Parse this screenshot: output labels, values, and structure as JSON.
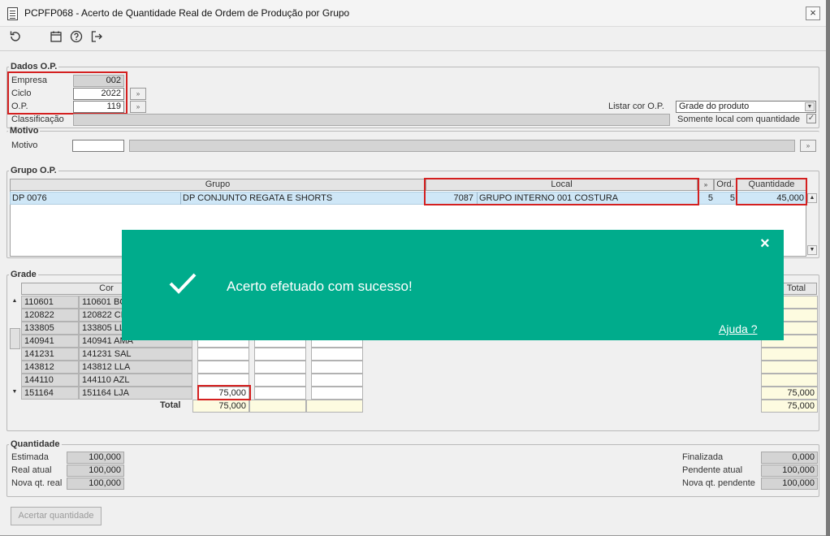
{
  "window": {
    "title": "PCPFP068 - Acerto de Quantidade Real de Ordem de Produção por Grupo",
    "close_label": "×"
  },
  "toolbar": {
    "icons": [
      "refresh-icon",
      "calendar-icon",
      "help-icon",
      "exit-icon"
    ]
  },
  "dados_op": {
    "legend": "Dados O.P.",
    "empresa_label": "Empresa",
    "empresa_value": "002",
    "ciclo_label": "Ciclo",
    "ciclo_value": "2022",
    "op_label": "O.P.",
    "op_value": "119",
    "classificacao_label": "Classificação",
    "classificacao_value": "",
    "listar_cor_label": "Listar cor O.P.",
    "listar_cor_value": "Grade do produto",
    "somente_local_label": "Somente local com quantidade",
    "somente_local_checked": true
  },
  "motivo": {
    "legend": "Motivo",
    "label": "Motivo",
    "code_value": "",
    "description_value": ""
  },
  "grupo_op": {
    "legend": "Grupo O.P.",
    "headers": {
      "grupo": "Grupo",
      "local": "Local",
      "ord": "Ord.",
      "quantidade": "Quantidade"
    },
    "rows": [
      {
        "grupo_code": "DP 0076",
        "grupo_name": "DP CONJUNTO REGATA E SHORTS",
        "local_code": "7087",
        "local_name": "GRUPO INTERNO 001 COSTURA",
        "col_a": "5",
        "ord": "5",
        "quantidade": "45,000"
      }
    ]
  },
  "grade": {
    "legend": "Grade",
    "cor_header": "Cor",
    "total_header": "Total",
    "rows": [
      {
        "code": "110601",
        "cor": "110601 BC",
        "q1": "",
        "total": ""
      },
      {
        "code": "120822",
        "cor": "120822 CF",
        "q1": "",
        "total": ""
      },
      {
        "code": "133805",
        "cor": "133805 LL",
        "q1": "",
        "total": ""
      },
      {
        "code": "140941",
        "cor": "140941 AMA",
        "q1": "",
        "total": ""
      },
      {
        "code": "141231",
        "cor": "141231 SAL",
        "q1": "",
        "total": ""
      },
      {
        "code": "143812",
        "cor": "143812 LLA",
        "q1": "",
        "total": ""
      },
      {
        "code": "144110",
        "cor": "144110 AZL",
        "q1": "",
        "total": ""
      },
      {
        "code": "151164",
        "cor": "151164 LJA",
        "q1": "75,000",
        "total": "75,000"
      }
    ],
    "total_label": "Total",
    "total_q1": "75,000",
    "total_sum": "75,000"
  },
  "quantidade": {
    "legend": "Quantidade",
    "estimada_label": "Estimada",
    "estimada_value": "100,000",
    "real_atual_label": "Real atual",
    "real_atual_value": "100,000",
    "nova_qt_real_label": "Nova qt. real",
    "nova_qt_real_value": "100,000",
    "finalizada_label": "Finalizada",
    "finalizada_value": "0,000",
    "pendente_atual_label": "Pendente atual",
    "pendente_atual_value": "100,000",
    "nova_qt_pendente_label": "Nova qt. pendente",
    "nova_qt_pendente_value": "100,000"
  },
  "actions": {
    "acertar_label": "Acertar quantidade"
  },
  "toast": {
    "message": "Acerto efetuado com sucesso!",
    "help_link": "Ajuda ?",
    "close_label": "×",
    "color": "#00ac8c"
  }
}
